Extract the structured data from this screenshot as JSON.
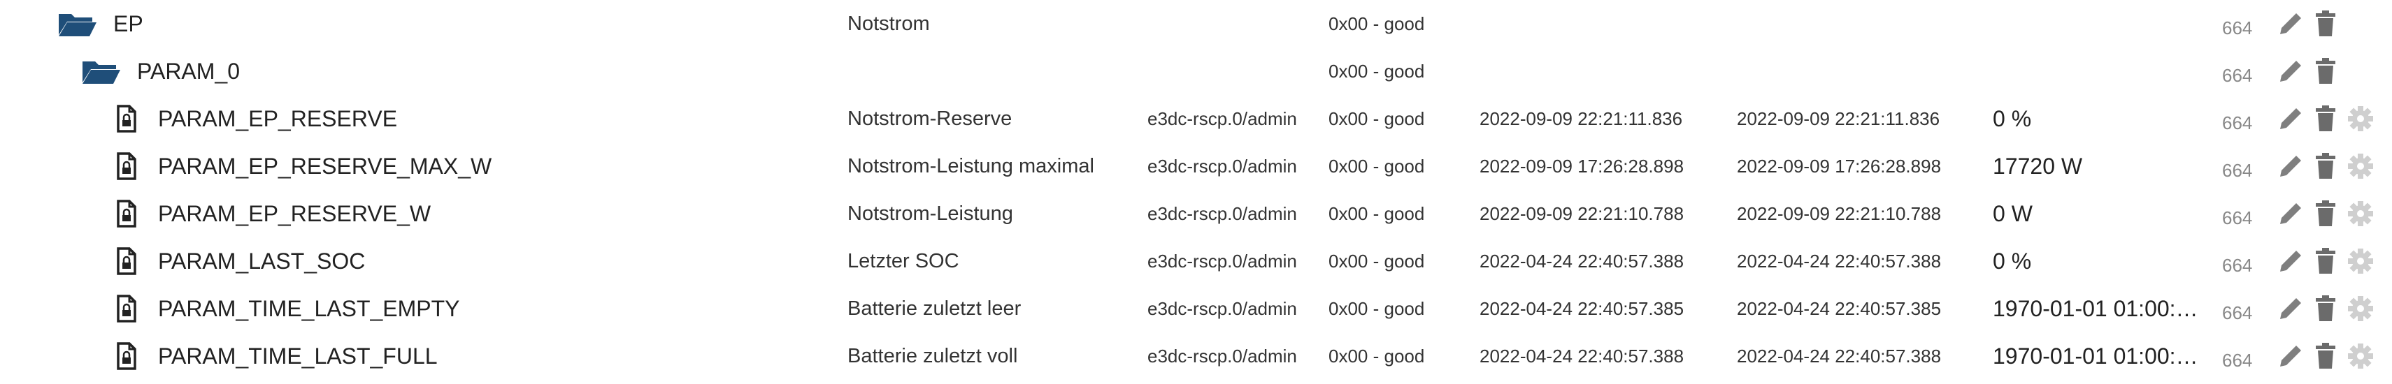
{
  "rows": [
    {
      "kind": "folder-open",
      "name": "EP",
      "description": "Notstrom",
      "role": "",
      "status": "0x00 - good",
      "ts": "",
      "lc": "",
      "value": "",
      "acl": "664",
      "has_config": false
    },
    {
      "kind": "folder-open",
      "name": "PARAM_0",
      "description": "",
      "role": "",
      "status": "0x00 - good",
      "ts": "",
      "lc": "",
      "value": "",
      "acl": "664",
      "has_config": false
    },
    {
      "kind": "file-lock",
      "name": "PARAM_EP_RESERVE",
      "description": "Notstrom-Reserve",
      "role": "e3dc-rscp.0/admin",
      "status": "0x00 - good",
      "ts": "2022-09-09 22:21:11.836",
      "lc": "2022-09-09 22:21:11.836",
      "value": "0 %",
      "acl": "664",
      "has_config": true
    },
    {
      "kind": "file-lock",
      "name": "PARAM_EP_RESERVE_MAX_W",
      "description": "Notstrom-Leistung maximal",
      "role": "e3dc-rscp.0/admin",
      "status": "0x00 - good",
      "ts": "2022-09-09 17:26:28.898",
      "lc": "2022-09-09 17:26:28.898",
      "value": "17720 W",
      "acl": "664",
      "has_config": true
    },
    {
      "kind": "file-lock",
      "name": "PARAM_EP_RESERVE_W",
      "description": "Notstrom-Leistung",
      "role": "e3dc-rscp.0/admin",
      "status": "0x00 - good",
      "ts": "2022-09-09 22:21:10.788",
      "lc": "2022-09-09 22:21:10.788",
      "value": "0 W",
      "acl": "664",
      "has_config": true
    },
    {
      "kind": "file-lock",
      "name": "PARAM_LAST_SOC",
      "description": "Letzter SOC",
      "role": "e3dc-rscp.0/admin",
      "status": "0x00 - good",
      "ts": "2022-04-24 22:40:57.388",
      "lc": "2022-04-24 22:40:57.388",
      "value": "0 %",
      "acl": "664",
      "has_config": true
    },
    {
      "kind": "file-lock",
      "name": "PARAM_TIME_LAST_EMPTY",
      "description": "Batterie zuletzt leer",
      "role": "e3dc-rscp.0/admin",
      "status": "0x00 - good",
      "ts": "2022-04-24 22:40:57.385",
      "lc": "2022-04-24 22:40:57.385",
      "value": "1970-01-01 01:00:…",
      "acl": "664",
      "has_config": true
    },
    {
      "kind": "file-lock",
      "name": "PARAM_TIME_LAST_FULL",
      "description": "Batterie zuletzt voll",
      "role": "e3dc-rscp.0/admin",
      "status": "0x00 - good",
      "ts": "2022-04-24 22:40:57.388",
      "lc": "2022-04-24 22:40:57.388",
      "value": "1970-01-01 01:00:…",
      "acl": "664",
      "has_config": true
    }
  ],
  "colors": {
    "folder": "#1f4e79",
    "file": "#222222",
    "edit": "#7f7f7f",
    "delete": "#6b6b6b",
    "config": "#cfcfcf"
  },
  "icons": {
    "folder": "folder-open-icon",
    "file": "file-lock-icon",
    "edit": "pencil-icon",
    "delete": "trash-icon",
    "config": "gear-icon"
  }
}
